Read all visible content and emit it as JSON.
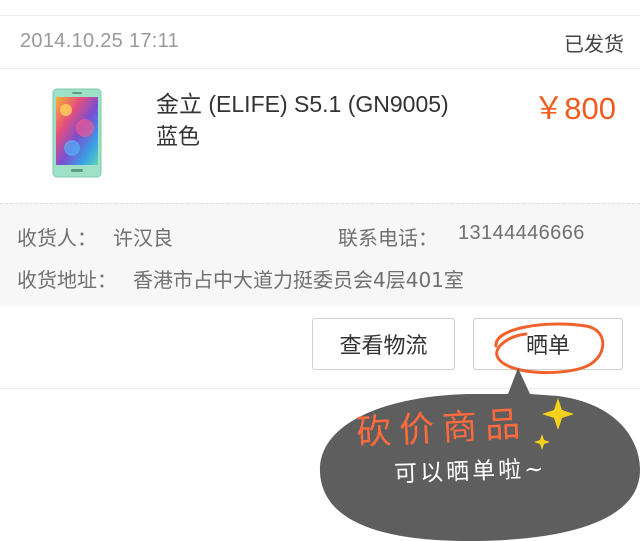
{
  "order": {
    "date": "2014.10.25 17:11",
    "status": "已发货"
  },
  "product": {
    "name": "金立 (ELIFE) S5.1 (GN9005)",
    "variant": "蓝色",
    "price": "￥800",
    "image_icon": "phone-image"
  },
  "shipping": {
    "receiver_label": "收货人：",
    "receiver_name": "许汉良",
    "phone_label": "联系电话：",
    "phone": "13144446666",
    "address_label": "收货地址：",
    "address": "香港市占中大道力挺委员会4层401室"
  },
  "actions": {
    "logistics_label": "查看物流",
    "share_label": "晒单"
  },
  "promo": {
    "title": "砍价商品",
    "subtitle": "可以晒单啦~"
  },
  "colors": {
    "accent": "#f25b1e",
    "promo_bubble": "#5e5e5e",
    "promo_title": "#ff6b3d",
    "sparkle": "#f3d11c"
  }
}
